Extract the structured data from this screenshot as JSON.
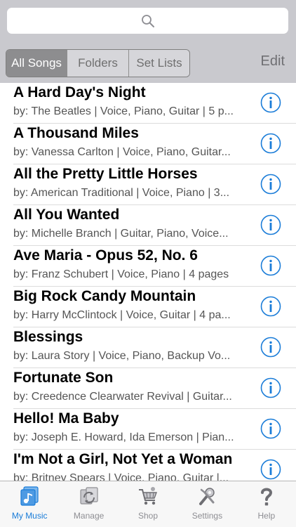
{
  "search": {
    "icon": "search-icon"
  },
  "segments": [
    {
      "label": "All Songs",
      "active": true
    },
    {
      "label": "Folders",
      "active": false
    },
    {
      "label": "Set Lists",
      "active": false
    }
  ],
  "edit_label": "Edit",
  "songs": [
    {
      "title": "A Hard Day's Night",
      "subtitle": "by: The Beatles | Voice, Piano, Guitar | 5 p..."
    },
    {
      "title": "A Thousand Miles",
      "subtitle": "by: Vanessa Carlton | Voice, Piano, Guitar..."
    },
    {
      "title": "All the Pretty Little Horses",
      "subtitle": "by: American Traditional | Voice, Piano | 3..."
    },
    {
      "title": "All You Wanted",
      "subtitle": "by: Michelle Branch | Guitar, Piano, Voice..."
    },
    {
      "title": "Ave Maria - Opus 52, No. 6",
      "subtitle": "by: Franz Schubert | Voice, Piano | 4 pages"
    },
    {
      "title": "Big Rock Candy Mountain",
      "subtitle": "by: Harry McClintock | Voice, Guitar | 4 pa..."
    },
    {
      "title": "Blessings",
      "subtitle": "by: Laura Story | Voice, Piano, Backup Vo..."
    },
    {
      "title": "Fortunate Son",
      "subtitle": "by: Creedence Clearwater Revival | Guitar..."
    },
    {
      "title": "Hello! Ma Baby",
      "subtitle": "by: Joseph E. Howard, Ida Emerson | Pian..."
    },
    {
      "title": "I'm Not a Girl, Not Yet a Woman",
      "subtitle": "by: Britney Spears | Voice, Piano, Guitar |..."
    }
  ],
  "tabs": [
    {
      "label": "My Music",
      "icon": "my-music-icon",
      "active": true
    },
    {
      "label": "Manage",
      "icon": "manage-icon",
      "active": false
    },
    {
      "label": "Shop",
      "icon": "shop-cart-icon",
      "active": false
    },
    {
      "label": "Settings",
      "icon": "settings-icon",
      "active": false
    },
    {
      "label": "Help",
      "icon": "help-icon",
      "active": false
    }
  ],
  "colors": {
    "accent": "#1a7cd8",
    "header_bg": "#c9c9ce",
    "segment_active_bg": "#8d8d8f",
    "tab_inactive": "#8e8e93"
  }
}
